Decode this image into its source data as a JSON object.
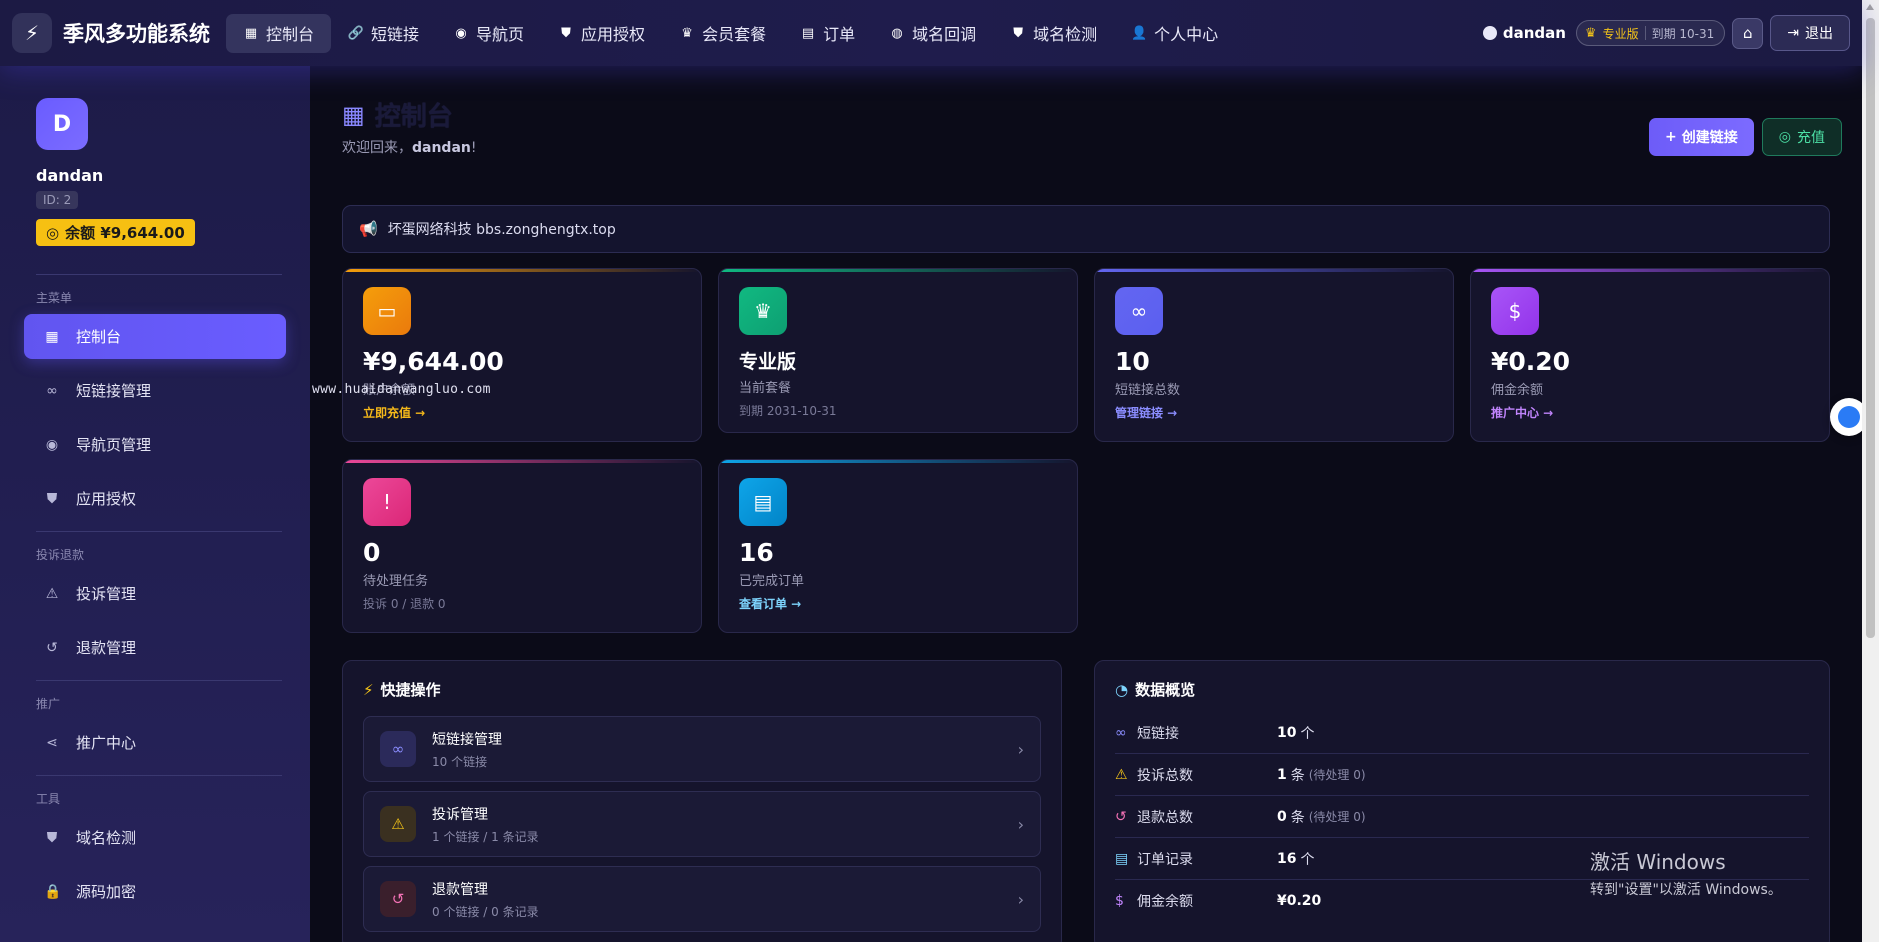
{
  "app": {
    "logo_icon": "bolt-icon",
    "brand": "季风多功能系统"
  },
  "nav": [
    {
      "label": "控制台",
      "icon": "grid-icon",
      "active": true
    },
    {
      "label": "短链接",
      "icon": "link-icon"
    },
    {
      "label": "导航页",
      "icon": "compass-icon"
    },
    {
      "label": "应用授权",
      "icon": "shield-icon"
    },
    {
      "label": "会员套餐",
      "icon": "crown-icon"
    },
    {
      "label": "订单",
      "icon": "receipt-icon"
    },
    {
      "label": "域名回调",
      "icon": "globe-icon"
    },
    {
      "label": "域名检测",
      "icon": "shield-icon"
    },
    {
      "label": "个人中心",
      "icon": "user-icon"
    }
  ],
  "top_right": {
    "username": "dandan",
    "plan": "专业版",
    "expire": "到期 10-31",
    "logout": "退出"
  },
  "sidebar": {
    "avatar_letter": "D",
    "name": "dandan",
    "id": "ID: 2",
    "balance": "余额 ¥9,644.00",
    "sections": [
      {
        "title": "主菜单",
        "items": [
          "控制台",
          "短链接管理",
          "导航页管理",
          "应用授权"
        ]
      },
      {
        "title": "投诉退款",
        "items": [
          "投诉管理",
          "退款管理"
        ]
      },
      {
        "title": "推广",
        "items": [
          "推广中心"
        ]
      },
      {
        "title": "工具",
        "items": [
          "域名检测",
          "源码加密"
        ]
      }
    ]
  },
  "page": {
    "title": "控制台",
    "welcome_prefix": "欢迎回来，",
    "welcome_name": "dandan",
    "welcome_suffix": "!",
    "create_btn": "创建链接",
    "recharge_btn": "充值",
    "notice": "坏蛋网络科技 bbs.zonghengtx.top"
  },
  "cards": [
    {
      "value": "¥9,644.00",
      "label": "账户余额",
      "link": "立即充值 →"
    },
    {
      "value": "专业版",
      "label": "当前套餐",
      "sub": "到期 2031-10-31"
    },
    {
      "value": "10",
      "label": "短链接总数",
      "link": "管理链接 →"
    },
    {
      "value": "¥0.20",
      "label": "佣金余额",
      "link": "推广中心 →"
    },
    {
      "value": "0",
      "label": "待处理任务",
      "sub": "投诉 0 / 退款 0"
    },
    {
      "value": "16",
      "label": "已完成订单",
      "link": "查看订单 →"
    }
  ],
  "watermark": "www.huaidanwangluo.com",
  "quick": {
    "title": "快捷操作",
    "items": [
      {
        "title": "短链接管理",
        "sub": "10 个链接"
      },
      {
        "title": "投诉管理",
        "sub": "1 个链接 / 1 条记录"
      },
      {
        "title": "退款管理",
        "sub": "0 个链接 / 0 条记录"
      }
    ]
  },
  "overview": {
    "title": "数据概览",
    "rows": [
      {
        "label": "短链接",
        "value": "10",
        "unit": "个",
        "note": ""
      },
      {
        "label": "投诉总数",
        "value": "1",
        "unit": "条",
        "note": "(待处理 0)"
      },
      {
        "label": "退款总数",
        "value": "0",
        "unit": "条",
        "note": "(待处理 0)"
      },
      {
        "label": "订单记录",
        "value": "16",
        "unit": "个",
        "note": ""
      },
      {
        "label": "佣金余额",
        "value": "¥0.20",
        "unit": "",
        "note": ""
      }
    ]
  },
  "os_notice": {
    "line1": "激活 Windows",
    "line2": "转到\"设置\"以激活 Windows。"
  },
  "colors": {
    "accent": "#6a5dff",
    "balance_badge": "#f6c012",
    "card_orange": "#f59e0b",
    "card_green": "#10b981",
    "card_indigo": "#6366f1",
    "card_purple": "#a855f7",
    "card_pink": "#ec4899",
    "card_sky": "#0ea5e9"
  }
}
